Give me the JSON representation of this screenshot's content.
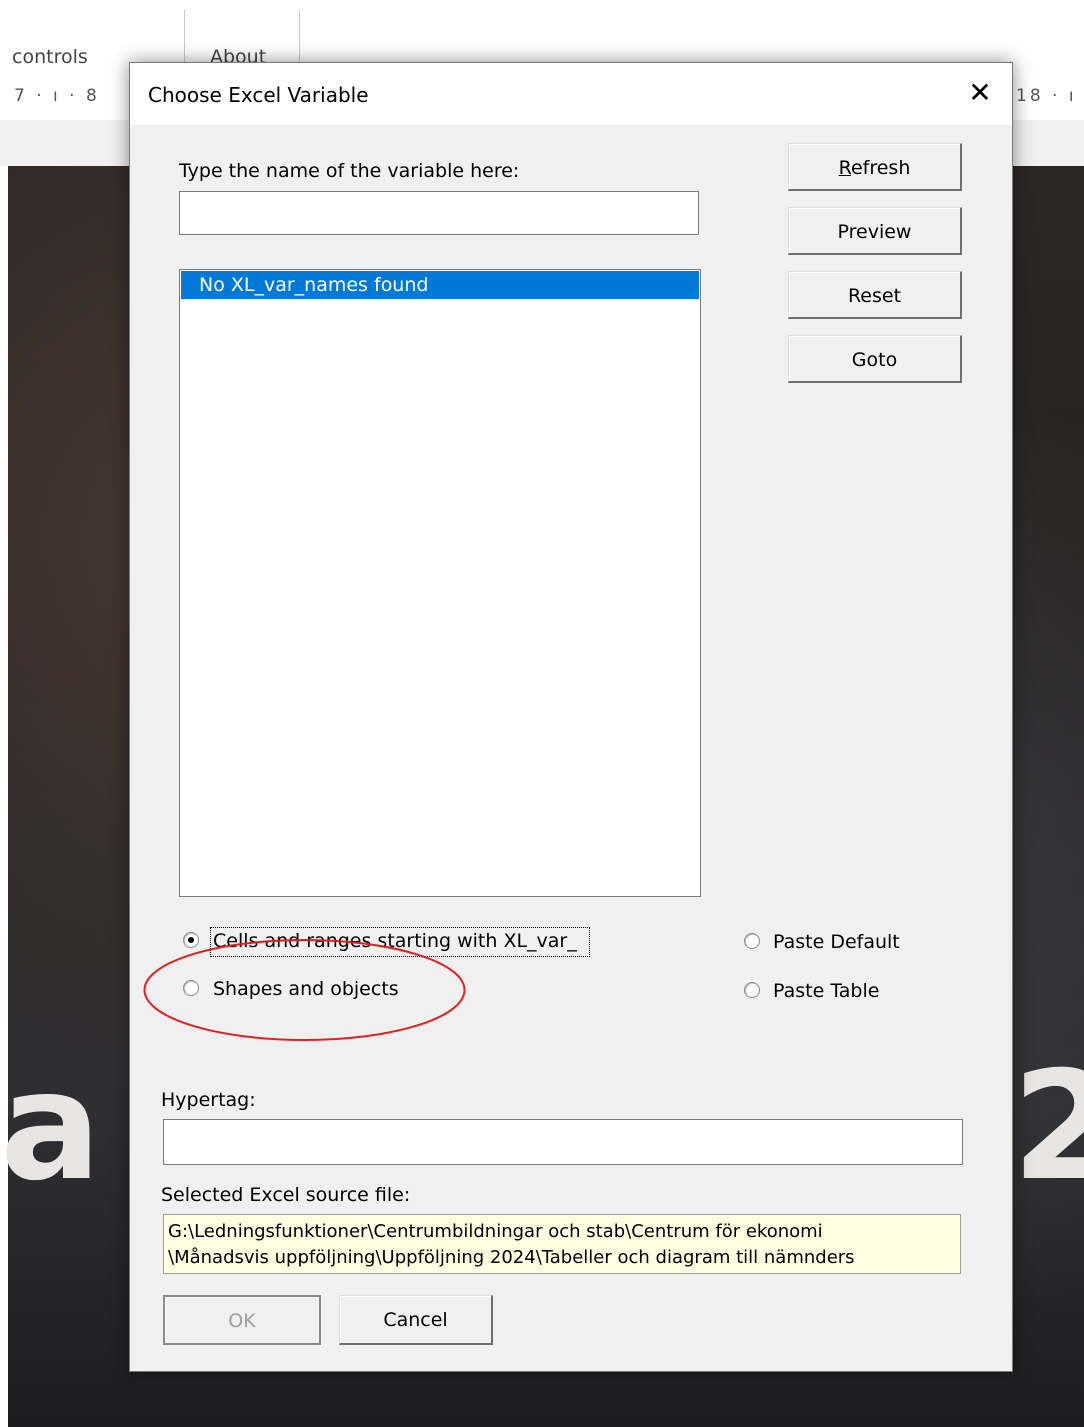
{
  "background_app": {
    "tabs": [
      "controls",
      "About"
    ],
    "ruler_left": "7 · ı · 8",
    "ruler_right": "18 · ı",
    "doc_text_left": "a",
    "doc_text_right": "2"
  },
  "dialog": {
    "title": "Choose Excel Variable",
    "close_symbol": "✕",
    "name_label": "Type the name of the variable here:",
    "name_value": "",
    "list_items": [
      "No XL_var_names found"
    ],
    "buttons": {
      "refresh": "Refresh",
      "preview": "Preview",
      "reset": "Reset",
      "goto": "Goto",
      "ok": "OK",
      "cancel": "Cancel"
    },
    "source_options": [
      {
        "label": "Cells and ranges starting with XL_var_",
        "checked": true
      },
      {
        "label": "Shapes and objects",
        "checked": false
      }
    ],
    "paste_options": [
      {
        "label": "Paste Default",
        "checked": false
      },
      {
        "label": "Paste Table",
        "checked": false
      }
    ],
    "hypertag_label": "Hypertag:",
    "hypertag_value": "",
    "source_file_label": "Selected Excel source file:",
    "source_file_lines": [
      "G:\\Ledningsfunktioner\\Centrumbildningar och stab\\Centrum för ekonomi",
      "\\Månadsvis uppföljning\\Uppföljning 2024\\Tabeller och diagram till nämnders"
    ]
  },
  "annotation_color": "#e02020",
  "highlight_color": "#0078d7"
}
